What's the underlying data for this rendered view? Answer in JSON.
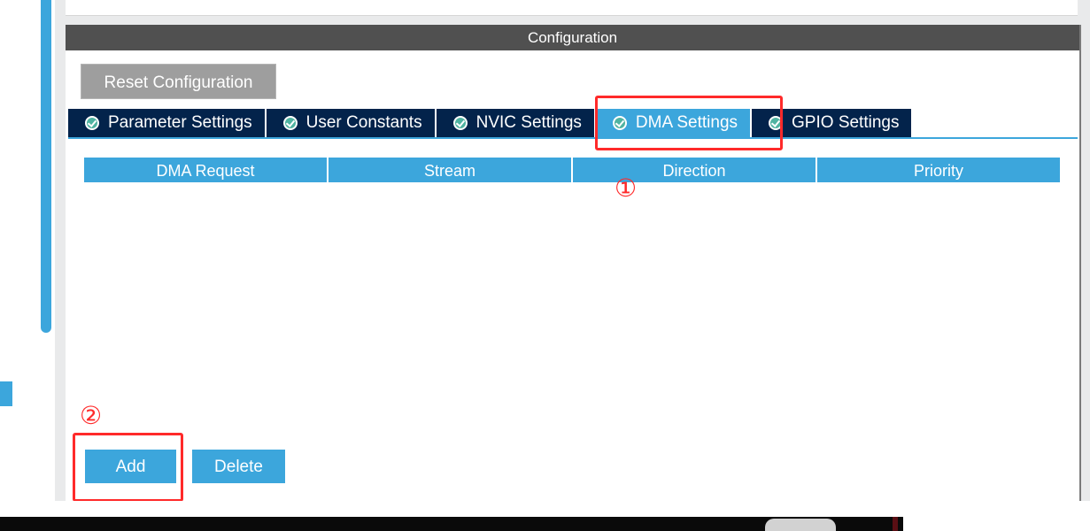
{
  "panel": {
    "title": "Configuration"
  },
  "buttons": {
    "reset": "Reset Configuration",
    "add": "Add",
    "delete": "Delete"
  },
  "tabs": [
    {
      "label": "Parameter Settings",
      "icon": "check-circle-icon",
      "active": false
    },
    {
      "label": "User Constants",
      "icon": "check-circle-icon",
      "active": false
    },
    {
      "label": "NVIC Settings",
      "icon": "check-circle-icon",
      "active": false
    },
    {
      "label": "DMA Settings",
      "icon": "check-circle-icon",
      "active": true
    },
    {
      "label": "GPIO Settings",
      "icon": "check-circle-icon",
      "active": false
    }
  ],
  "table": {
    "columns": [
      "DMA Request",
      "Stream",
      "Direction",
      "Priority"
    ],
    "rows": []
  },
  "annotations": {
    "marker_1": "①",
    "marker_2": "②"
  },
  "colors": {
    "accent": "#3ca6dc",
    "tab_dark": "#03234b",
    "header_gray": "#505050",
    "highlight_red": "#ff2a2a"
  }
}
